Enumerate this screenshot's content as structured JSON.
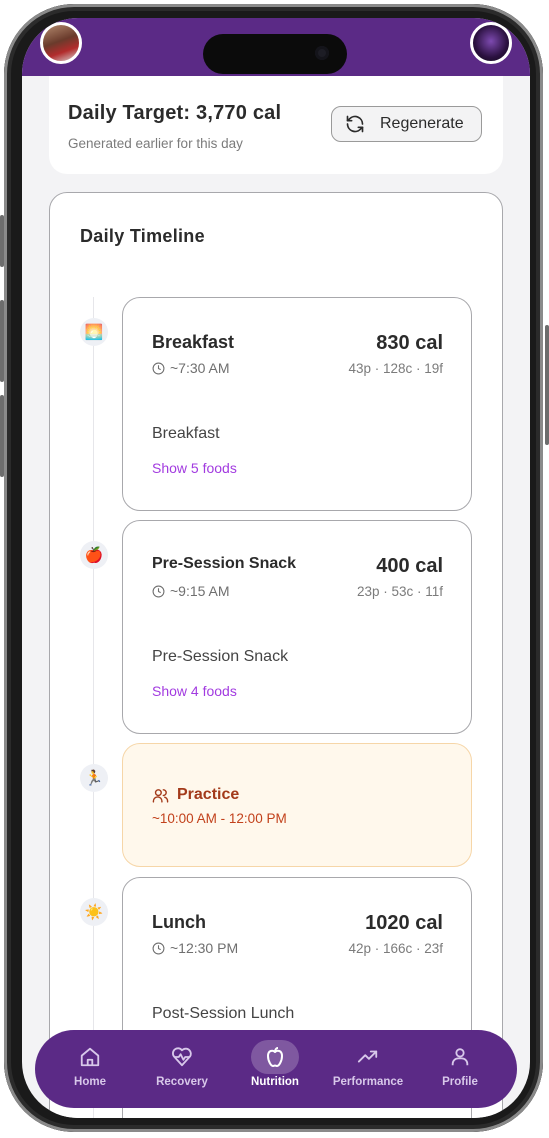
{
  "colors": {
    "brand_purple": "#5b2a86",
    "link_purple": "#a23be0",
    "practice_text": "#a33a1a",
    "practice_bg": "#fff8ec"
  },
  "target": {
    "title": "Daily Target: 3,770 cal",
    "subtitle": "Generated earlier for this day",
    "regenerate_label": "Regenerate"
  },
  "timeline": {
    "title": "Daily Timeline",
    "meals": [
      {
        "icon": "sunrise-icon",
        "emoji": "🌅",
        "name": "Breakfast",
        "time": "~7:30 AM",
        "calories": "830 cal",
        "macros": "43p · 128c · 19f",
        "description": "Breakfast",
        "link": "Show 5 foods"
      },
      {
        "icon": "apple-icon",
        "emoji": "🍎",
        "name": "Pre-Session Snack",
        "time": "~9:15 AM",
        "calories": "400 cal",
        "macros": "23p · 53c · 11f",
        "description": "Pre-Session Snack",
        "link": "Show 4 foods"
      },
      {
        "icon": "sun-icon",
        "emoji": "☀️",
        "name": "Lunch",
        "time": "~12:30 PM",
        "calories": "1020 cal",
        "macros": "42p · 166c · 23f",
        "description": "Post-Session Lunch",
        "link": ""
      }
    ],
    "practice": {
      "icon": "running-icon",
      "emoji": "🏃",
      "title": "Practice",
      "time": "~10:00 AM - 12:00 PM"
    }
  },
  "nav": {
    "items": [
      {
        "label": "Home",
        "icon": "home-icon"
      },
      {
        "label": "Recovery",
        "icon": "heart-pulse-icon"
      },
      {
        "label": "Nutrition",
        "icon": "apple-icon",
        "active": true
      },
      {
        "label": "Performance",
        "icon": "trending-up-icon"
      },
      {
        "label": "Profile",
        "icon": "user-icon"
      }
    ]
  }
}
